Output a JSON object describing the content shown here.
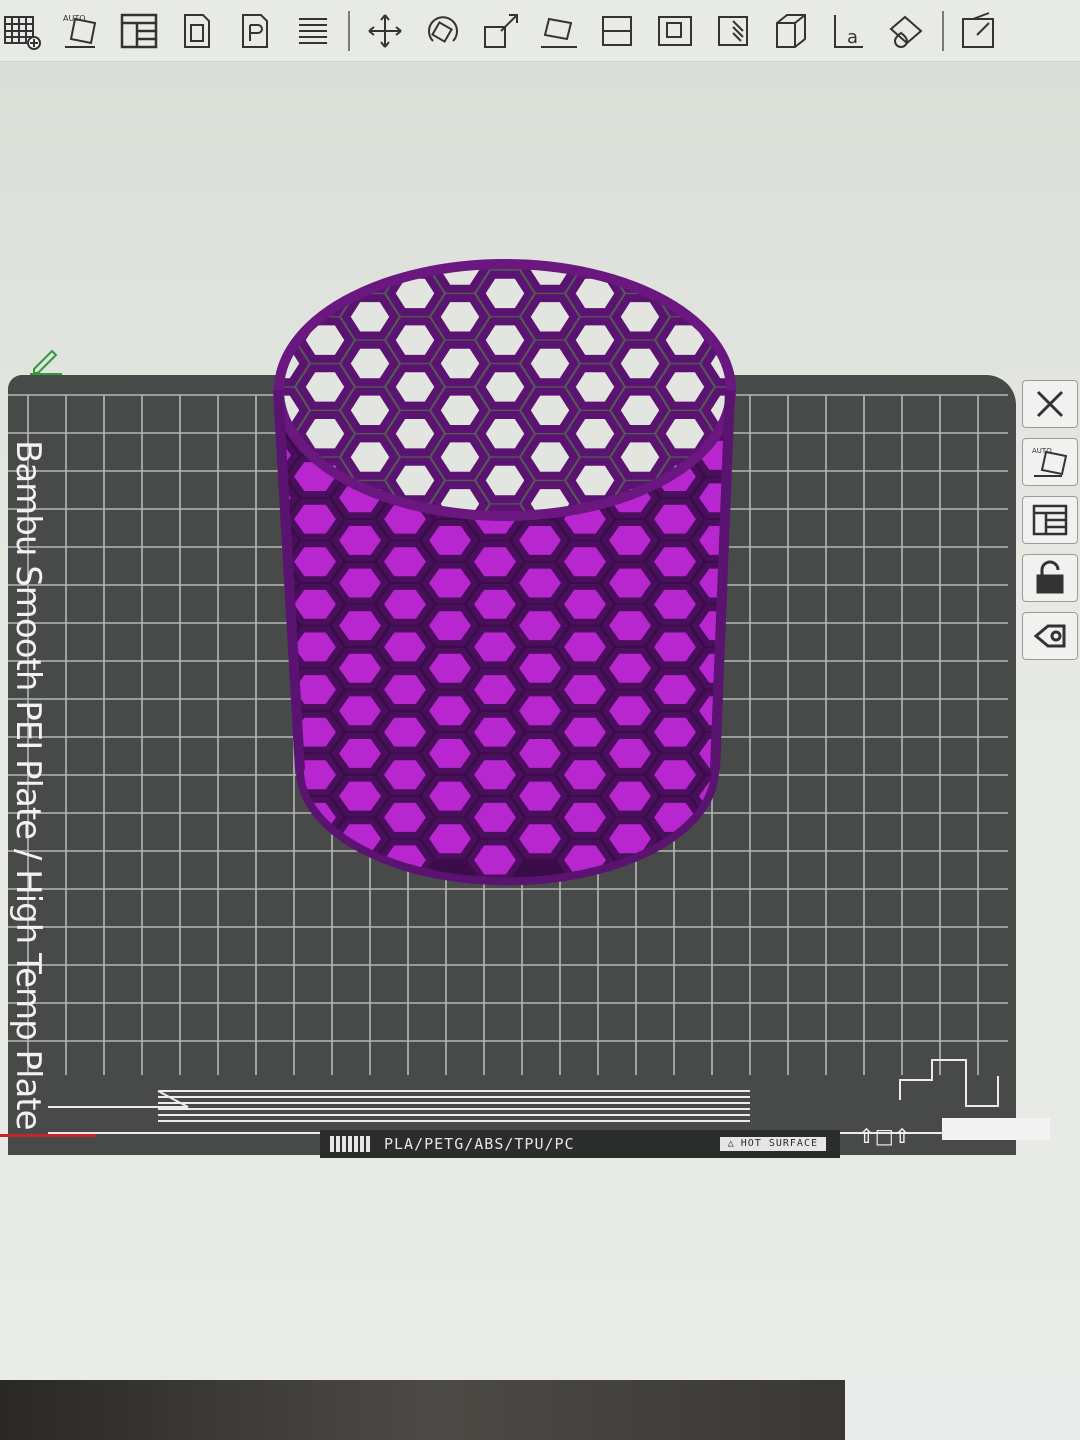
{
  "toolbar": {
    "items": [
      {
        "icon": "arrange-grid-icon"
      },
      {
        "icon": "auto-orient-icon",
        "label": "AUTO"
      },
      {
        "icon": "layout-icon"
      },
      {
        "icon": "split-objects-icon"
      },
      {
        "icon": "split-parts-icon"
      },
      {
        "icon": "variable-layer-icon"
      },
      {
        "icon": "move-icon"
      },
      {
        "icon": "rotate-icon"
      },
      {
        "icon": "scale-icon"
      },
      {
        "icon": "lay-on-face-icon"
      },
      {
        "icon": "cut-icon"
      },
      {
        "icon": "boolean-icon"
      },
      {
        "icon": "support-paint-icon"
      },
      {
        "icon": "seam-paint-icon"
      },
      {
        "icon": "text-icon",
        "label": "a"
      },
      {
        "icon": "color-paint-icon"
      },
      {
        "icon": "assembly-icon"
      }
    ]
  },
  "plate": {
    "name": "Bambu Smooth PEI Plate / High Temp Plate",
    "filaments": "PLA/PETG/ABS/TPU/PC",
    "hot_surface": "HOT SURFACE"
  },
  "side_tools": [
    {
      "icon": "close-icon"
    },
    {
      "icon": "auto-orient-icon",
      "label": "AUTO"
    },
    {
      "icon": "arrange-icon"
    },
    {
      "icon": "lock-icon"
    },
    {
      "icon": "settings-icon"
    }
  ],
  "model": {
    "name": "hexagon-mesh-cylinder",
    "color": "#7a1a8a"
  },
  "colors": {
    "plate": "#474a49",
    "grid": "#c9ccc9",
    "accent": "#2e9a3a"
  }
}
